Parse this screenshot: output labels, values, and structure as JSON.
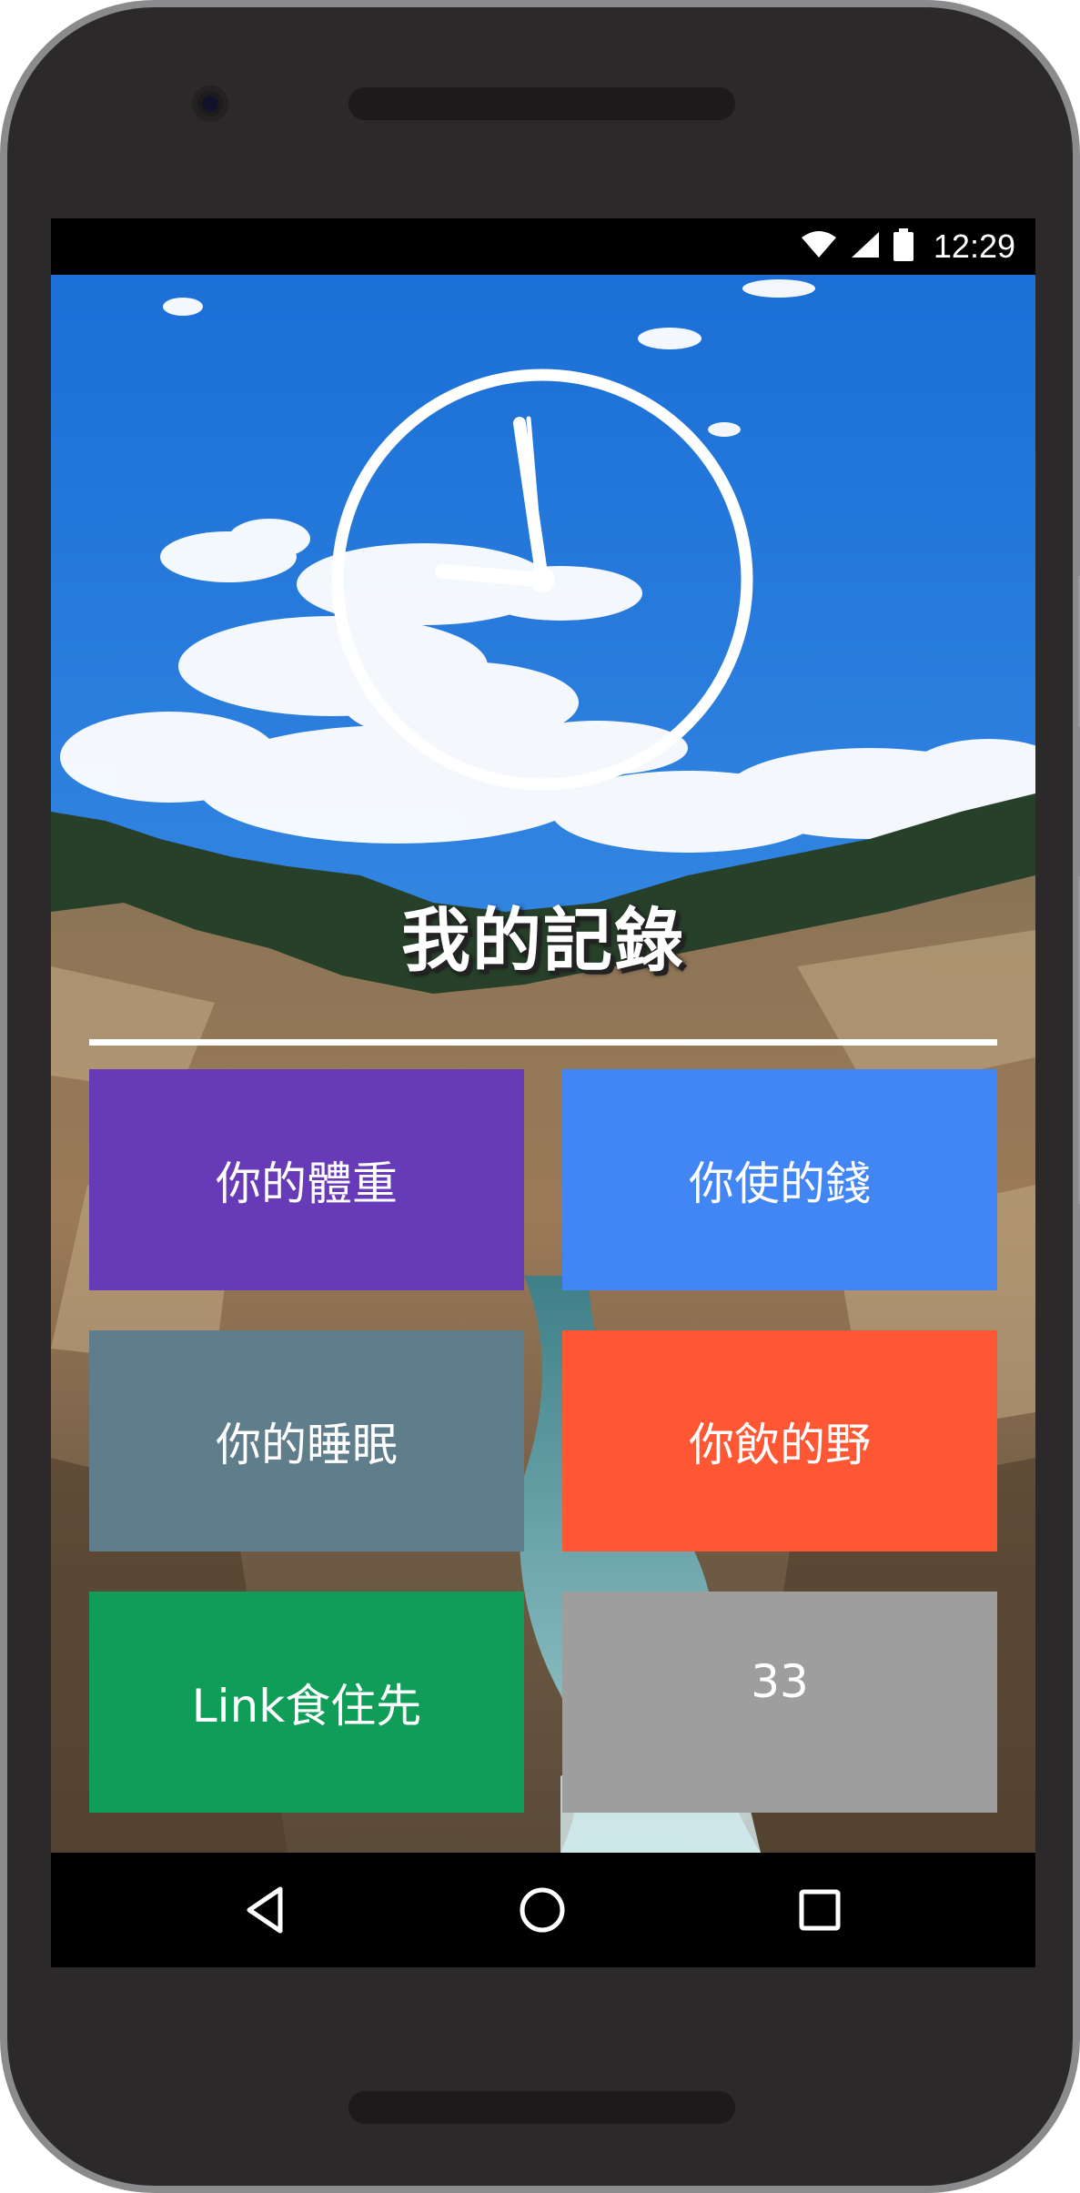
{
  "status_bar": {
    "time": "12:29",
    "icons": [
      "wifi-icon",
      "cell-signal-icon",
      "battery-icon"
    ]
  },
  "app": {
    "clock": {
      "hour_hand_points_to": "9",
      "minute_hand_points_to": "58"
    },
    "title": "我的記錄",
    "tiles": [
      {
        "label": "你的體重",
        "color": "#673ab7"
      },
      {
        "label": "你使的錢",
        "color": "#4285f4"
      },
      {
        "label": "你的睡眠",
        "color": "#607d8b"
      },
      {
        "label": "你飲的野",
        "color": "#ff5733"
      },
      {
        "label": "Link食住先",
        "color": "#0f9d58"
      },
      {
        "label": "33",
        "color": "#9e9e9e"
      }
    ]
  },
  "nav_bar": {
    "buttons": [
      "back-icon",
      "home-icon",
      "recents-icon"
    ]
  }
}
